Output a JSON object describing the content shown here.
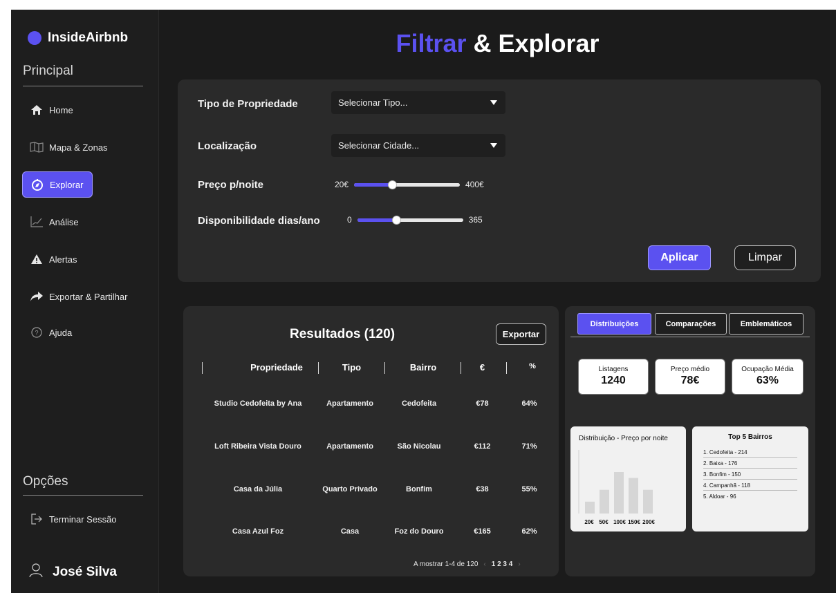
{
  "app": {
    "name": "InsideAirbnb",
    "title_accent": "Filtrar",
    "title_rest": " & Explorar"
  },
  "sidebar": {
    "section_main": "Principal",
    "items": [
      {
        "label": "Home",
        "icon": "home-icon"
      },
      {
        "label": "Mapa & Zonas",
        "icon": "map-icon"
      },
      {
        "label": "Explorar",
        "icon": "compass-icon",
        "active": true
      },
      {
        "label": "Análise",
        "icon": "chart-icon"
      },
      {
        "label": "Alertas",
        "icon": "warning-icon"
      },
      {
        "label": "Exportar & Partilhar",
        "icon": "share-icon"
      },
      {
        "label": "Ajuda",
        "icon": "help-icon"
      }
    ],
    "section_options": "Opções",
    "logout": "Terminar Sessão",
    "user": "José Silva"
  },
  "filters": {
    "type_label": "Tipo de Propriedade",
    "type_placeholder": "Selecionar Tipo...",
    "location_label": "Localização",
    "location_placeholder": "Selecionar Cidade...",
    "price_label": "Preço p/noite",
    "price_min": "20€",
    "price_max": "400€",
    "price_level": 0.36,
    "avail_label": "Disponibilidade dias/ano",
    "avail_min": "0",
    "avail_max": "365",
    "avail_level": 0.37,
    "apply": "Aplicar",
    "clear": "Limpar"
  },
  "results": {
    "title": "Resultados (120)",
    "export": "Exportar",
    "columns": [
      "Propriedade",
      "Tipo",
      "Bairro",
      "€",
      "%"
    ],
    "rows": [
      [
        "Studio Cedofeita by Ana",
        "Apartamento",
        "Cedofeita",
        "€78",
        "64%"
      ],
      [
        "Loft Ribeira Vista Douro",
        "Apartamento",
        "São Nicolau",
        "€112",
        "71%"
      ],
      [
        "Casa da Júlia",
        "Quarto Privado",
        "Bonfim",
        "€38",
        "55%"
      ],
      [
        "Casa Azul Foz",
        "Casa",
        "Foz do Douro",
        "€165",
        "62%"
      ]
    ],
    "pager_text": "A mostrar 1-4 de 120",
    "pages": "1 2 3 4"
  },
  "insights": {
    "tabs": [
      "Distribuições",
      "Comparações",
      "Emblemáticos"
    ],
    "kpis": [
      {
        "label": "Listagens",
        "value": "1240"
      },
      {
        "label": "Preço médio",
        "value": "78€"
      },
      {
        "label": "Ocupação Média",
        "value": "63%"
      }
    ],
    "histogram_title": "Distribuição - Preço por noite",
    "histogram_ticks": [
      "20€",
      "50€",
      "100€",
      "150€",
      "200€"
    ],
    "top_title": "Top 5 Bairros",
    "top_items": [
      "1. Cedofeita - 214",
      "2. Baixa - 176",
      "3. Bonfim - 150",
      "4. Campanhã - 118",
      "5. Aldoar - 96"
    ]
  },
  "chart_data": {
    "type": "bar",
    "categories": [
      "20€",
      "50€",
      "100€",
      "150€",
      "200€"
    ],
    "values": [
      2,
      4,
      7,
      6,
      4
    ],
    "title": "Distribuição - Preço por noite"
  }
}
